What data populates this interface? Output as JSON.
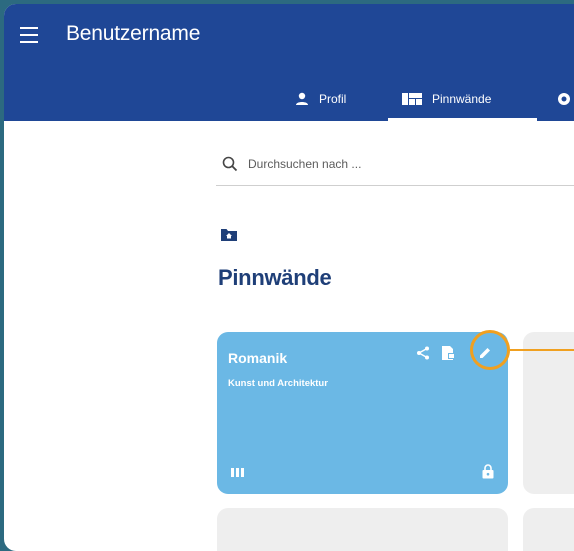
{
  "appbar": {
    "title": "Benutzername",
    "background": "#1f4796"
  },
  "tabs": [
    {
      "label": "Profil",
      "icon": "person-icon",
      "active": false
    },
    {
      "label": "Pinnwände",
      "icon": "board-icon",
      "active": true
    },
    {
      "label": "",
      "icon": "gear-icon",
      "active": false
    }
  ],
  "search": {
    "placeholder": "Durchsuchen nach ...",
    "value": ""
  },
  "section": {
    "icon": "folder-home-icon",
    "heading": "Pinnwände"
  },
  "cards": [
    {
      "title": "Romanik",
      "subtitle": "Kunst und Architektur",
      "color": "#6bb8e5",
      "actions": [
        "share-icon",
        "document-icon",
        "edit-icon"
      ],
      "footer_icons": [
        "grid-icon",
        "lock-icon"
      ]
    }
  ],
  "highlight": {
    "target": "edit-icon",
    "color": "#f0a020"
  }
}
